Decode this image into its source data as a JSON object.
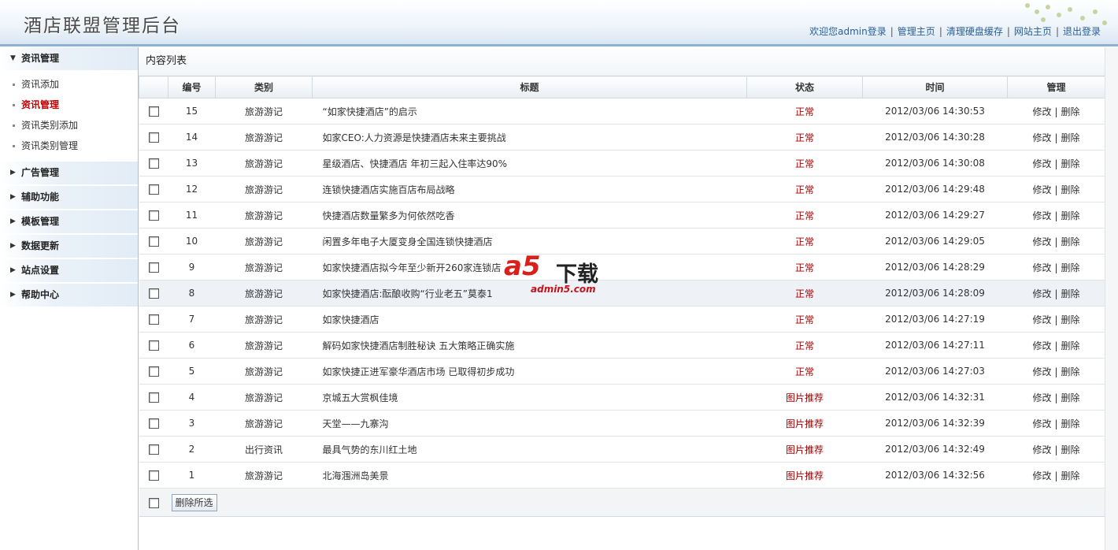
{
  "header": {
    "title": "酒店联盟管理后台",
    "links": [
      "欢迎您admin登录",
      "管理主页",
      "清理硬盘缓存",
      "网站主页",
      "退出登录"
    ]
  },
  "sidebar": {
    "groups": [
      {
        "label": "资讯管理",
        "expanded": true,
        "items": [
          "资讯添加",
          "资讯管理",
          "资讯类别添加",
          "资讯类别管理"
        ],
        "active_item": "资讯管理"
      },
      {
        "label": "广告管理",
        "expanded": false
      },
      {
        "label": "辅助功能",
        "expanded": false
      },
      {
        "label": "模板管理",
        "expanded": false
      },
      {
        "label": "数据更新",
        "expanded": false
      },
      {
        "label": "站点设置",
        "expanded": false
      },
      {
        "label": "帮助中心",
        "expanded": false
      }
    ]
  },
  "main": {
    "panel_title": "内容列表",
    "columns": [
      "",
      "编号",
      "类别",
      "标题",
      "状态",
      "时间",
      "管理"
    ],
    "edit_label": "修改",
    "delete_label": "删除",
    "rows": [
      {
        "id": "15",
        "category": "旅游游记",
        "title": "“如家快捷酒店”的启示",
        "status": "正常",
        "time": "2012/03/06 14:30:53"
      },
      {
        "id": "14",
        "category": "旅游游记",
        "title": "如家CEO:人力资源是快捷酒店未来主要挑战",
        "status": "正常",
        "time": "2012/03/06 14:30:28"
      },
      {
        "id": "13",
        "category": "旅游游记",
        "title": "星级酒店、快捷酒店 年初三起入住率达90%",
        "status": "正常",
        "time": "2012/03/06 14:30:08"
      },
      {
        "id": "12",
        "category": "旅游游记",
        "title": "连锁快捷酒店实施百店布局战略",
        "status": "正常",
        "time": "2012/03/06 14:29:48"
      },
      {
        "id": "11",
        "category": "旅游游记",
        "title": "快捷酒店数量繁多为何依然吃香",
        "status": "正常",
        "time": "2012/03/06 14:29:27"
      },
      {
        "id": "10",
        "category": "旅游游记",
        "title": "闲置多年电子大厦变身全国连锁快捷酒店",
        "status": "正常",
        "time": "2012/03/06 14:29:05"
      },
      {
        "id": "9",
        "category": "旅游游记",
        "title": "如家快捷酒店拟今年至少新开260家连锁店",
        "status": "正常",
        "time": "2012/03/06 14:28:29"
      },
      {
        "id": "8",
        "category": "旅游游记",
        "title": "如家快捷酒店:酝酿收购“行业老五”莫泰1",
        "status": "正常",
        "time": "2012/03/06 14:28:09",
        "highlight": true
      },
      {
        "id": "7",
        "category": "旅游游记",
        "title": "如家快捷酒店",
        "status": "正常",
        "time": "2012/03/06 14:27:19"
      },
      {
        "id": "6",
        "category": "旅游游记",
        "title": "解码如家快捷酒店制胜秘诀 五大策略正确实施",
        "status": "正常",
        "time": "2012/03/06 14:27:11"
      },
      {
        "id": "5",
        "category": "旅游游记",
        "title": "如家快捷正进军豪华酒店市场 已取得初步成功",
        "status": "正常",
        "time": "2012/03/06 14:27:03"
      },
      {
        "id": "4",
        "category": "旅游游记",
        "title": "京城五大赏枫佳境",
        "status": "图片推荐",
        "time": "2012/03/06 14:32:31"
      },
      {
        "id": "3",
        "category": "旅游游记",
        "title": "天堂——九寨沟",
        "status": "图片推荐",
        "time": "2012/03/06 14:32:39"
      },
      {
        "id": "2",
        "category": "出行资讯",
        "title": "最具气势的东川红土地",
        "status": "图片推荐",
        "time": "2012/03/06 14:32:49"
      },
      {
        "id": "1",
        "category": "旅游游记",
        "title": "北海涠洲岛美景",
        "status": "图片推荐",
        "time": "2012/03/06 14:32:56"
      }
    ],
    "delete_selected_label": "删除所选"
  },
  "watermark": {
    "logo": "a5",
    "text": "下载",
    "url": "admin5.com"
  }
}
